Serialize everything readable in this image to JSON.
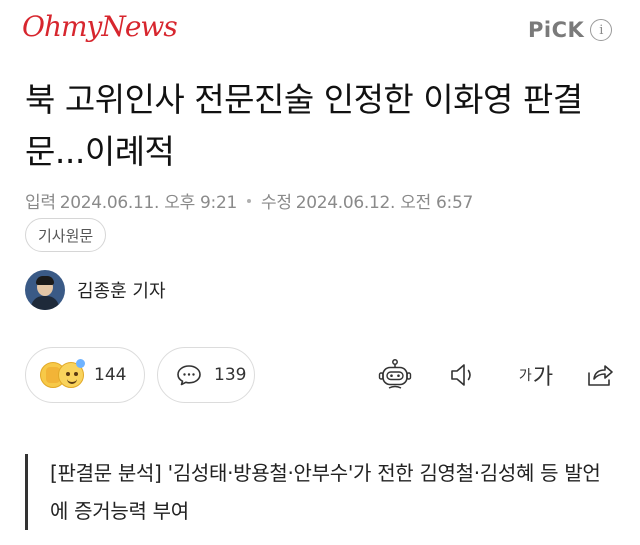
{
  "header": {
    "logo_text": "OhmyNews",
    "pick_label": "PiCK",
    "info_glyph": "i"
  },
  "article": {
    "title": "북 고위인사 전문진술 인정한 이화영 판결문...이례적",
    "input_label": "입력",
    "input_datetime": "2024.06.11. 오후 9:21",
    "modified_label": "수정",
    "modified_datetime": "2024.06.12. 오전 6:57",
    "original_button": "기사원문",
    "author": "김종훈 기자",
    "subtitle": "[판결문 분석] '김성태·방용철·안부수'가 전한 김영철·김성혜 등 발언에 증거능력 부여"
  },
  "actions": {
    "reaction_count": "144",
    "comment_count": "139",
    "font_small": "가",
    "font_big": "가"
  },
  "colors": {
    "brand": "#d7262e"
  }
}
